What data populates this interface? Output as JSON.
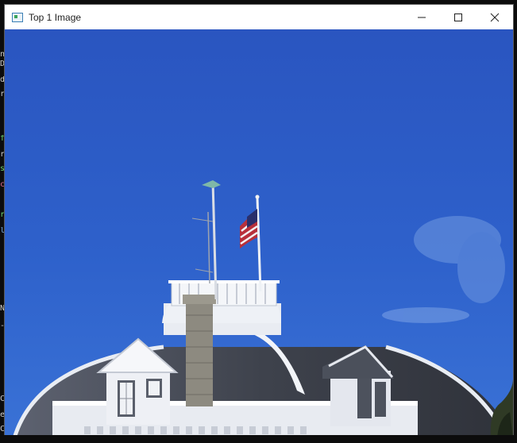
{
  "window": {
    "title": "Top 1 Image",
    "controls": {
      "minimize_icon": "minimize-icon",
      "maximize_icon": "maximize-icon",
      "close_icon": "close-icon"
    }
  },
  "image": {
    "subject": "domed building roof with flag and weather vane against blue sky",
    "sky_color": "#2f5fc7"
  }
}
